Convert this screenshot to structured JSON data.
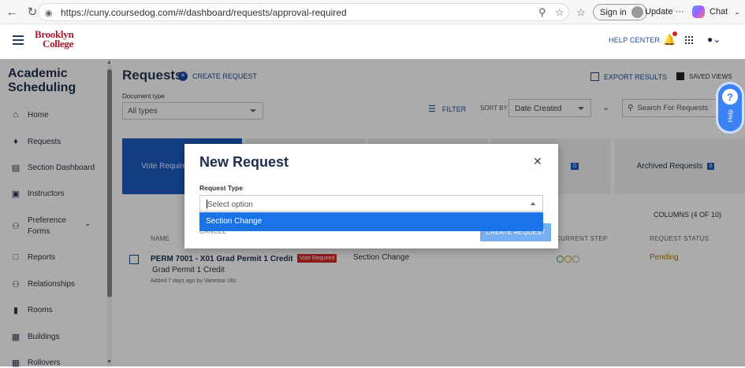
{
  "browser": {
    "url": "https://cuny.coursedog.com/#/dashboard/requests/approval-required",
    "signin_label": "Sign in",
    "update_label": "Update",
    "update_more": "···",
    "chat_label": "Chat"
  },
  "header": {
    "logo_line1": "Brooklyn",
    "logo_line2": "College",
    "help_center": "HELP CENTER"
  },
  "sidebar": {
    "title_line1": "Academic",
    "title_line2": "Scheduling",
    "items": [
      {
        "label": "Home"
      },
      {
        "label": "Requests"
      },
      {
        "label": "Section Dashboard"
      },
      {
        "label": "Instructors"
      },
      {
        "label": "Preference"
      },
      {
        "label": "Forms"
      },
      {
        "label": "Reports"
      },
      {
        "label": "Relationships"
      },
      {
        "label": "Rooms"
      },
      {
        "label": "Buildings"
      },
      {
        "label": "Rollovers"
      }
    ]
  },
  "main": {
    "title": "Requests",
    "create_request": "CREATE REQUEST",
    "export_results": "EXPORT RESULTS",
    "saved_views": "SAVED VIEWS",
    "doc_type_label": "Document type",
    "doc_type_value": "All types",
    "filter": "FILTER",
    "sort_by": "SORT BY",
    "sort_value": "Date Created",
    "search_placeholder": "Search For Requests",
    "help_tab": "Help",
    "cards": {
      "vote_required": "Vote Required",
      "archived": "Archived Requests",
      "archived_count": "0",
      "hidden_count": "0"
    },
    "columns_link": "COLUMNS (4 OF 10)",
    "headers": {
      "name": "NAME",
      "current_step": "CURRENT STEP",
      "status": "REQUEST STATUS"
    },
    "row": {
      "title": "PERM 7001 - X01 Grad Permit 1 Credit",
      "badge": "Vote Required",
      "subtitle": "Grad Permit 1 Credit",
      "added": "Added 7 days ago by Vanessa Ullo",
      "type": "Section Change",
      "status": "Pending"
    }
  },
  "modal": {
    "title": "New Request",
    "field_label": "Request Type",
    "placeholder": "Select option",
    "options": [
      {
        "label": "Section Change"
      }
    ],
    "cancel": "CANCEL",
    "create": "CREATE REQUEST"
  },
  "colors": {
    "accent": "#1d5bbf",
    "link": "#1a4a9c",
    "brand": "#a6192e",
    "dropdown_highlight": "#1b73e8",
    "pending": "#b07a00",
    "badge": "#d12c2c"
  }
}
